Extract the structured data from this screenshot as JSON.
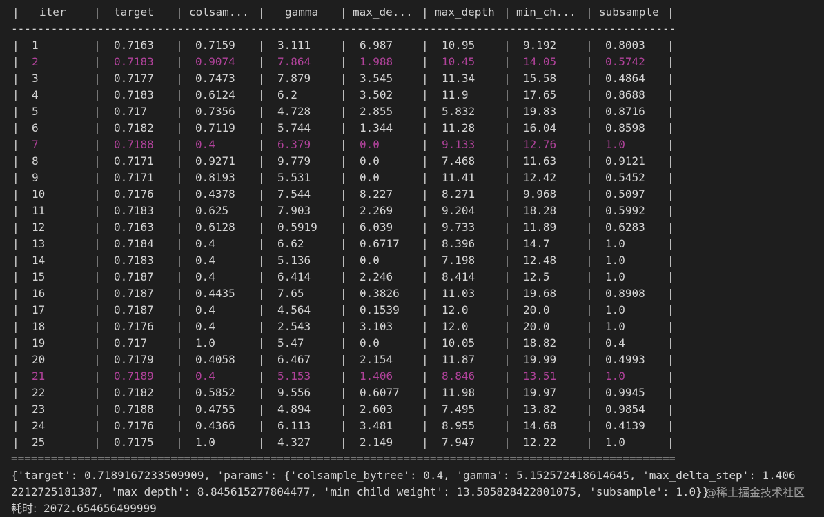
{
  "header": {
    "columns": [
      "iter",
      "target",
      "colsam...",
      "gamma",
      "max_de...",
      "max_depth",
      "min_ch...",
      "subsample"
    ]
  },
  "rows": [
    {
      "highlight": false,
      "cells": [
        "1",
        "0.7163",
        "0.7159",
        "3.111",
        "6.987",
        "10.95",
        "9.192",
        "0.8003"
      ]
    },
    {
      "highlight": true,
      "cells": [
        "2",
        "0.7183",
        "0.9074",
        "7.864",
        "1.988",
        "10.45",
        "14.05",
        "0.5742"
      ]
    },
    {
      "highlight": false,
      "cells": [
        "3",
        "0.7177",
        "0.7473",
        "7.879",
        "3.545",
        "11.34",
        "15.58",
        "0.4864"
      ]
    },
    {
      "highlight": false,
      "cells": [
        "4",
        "0.7183",
        "0.6124",
        "6.2",
        "3.502",
        "11.9",
        "17.65",
        "0.8688"
      ]
    },
    {
      "highlight": false,
      "cells": [
        "5",
        "0.717",
        "0.7356",
        "4.728",
        "2.855",
        "5.832",
        "19.83",
        "0.8716"
      ]
    },
    {
      "highlight": false,
      "cells": [
        "6",
        "0.7182",
        "0.7119",
        "5.744",
        "1.344",
        "11.28",
        "16.04",
        "0.8598"
      ]
    },
    {
      "highlight": true,
      "cells": [
        "7",
        "0.7188",
        "0.4",
        "6.379",
        "0.0",
        "9.133",
        "12.76",
        "1.0"
      ]
    },
    {
      "highlight": false,
      "cells": [
        "8",
        "0.7171",
        "0.9271",
        "9.779",
        "0.0",
        "7.468",
        "11.63",
        "0.9121"
      ]
    },
    {
      "highlight": false,
      "cells": [
        "9",
        "0.7171",
        "0.8193",
        "5.531",
        "0.0",
        "11.41",
        "12.42",
        "0.5452"
      ]
    },
    {
      "highlight": false,
      "cells": [
        "10",
        "0.7176",
        "0.4378",
        "7.544",
        "8.227",
        "8.271",
        "9.968",
        "0.5097"
      ]
    },
    {
      "highlight": false,
      "cells": [
        "11",
        "0.7183",
        "0.625",
        "7.903",
        "2.269",
        "9.204",
        "18.28",
        "0.5992"
      ]
    },
    {
      "highlight": false,
      "cells": [
        "12",
        "0.7163",
        "0.6128",
        "0.5919",
        "6.039",
        "9.733",
        "11.89",
        "0.6283"
      ]
    },
    {
      "highlight": false,
      "cells": [
        "13",
        "0.7184",
        "0.4",
        "6.62",
        "0.6717",
        "8.396",
        "14.7",
        "1.0"
      ]
    },
    {
      "highlight": false,
      "cells": [
        "14",
        "0.7183",
        "0.4",
        "5.136",
        "0.0",
        "7.198",
        "12.48",
        "1.0"
      ]
    },
    {
      "highlight": false,
      "cells": [
        "15",
        "0.7187",
        "0.4",
        "6.414",
        "2.246",
        "8.414",
        "12.5",
        "1.0"
      ]
    },
    {
      "highlight": false,
      "cells": [
        "16",
        "0.7187",
        "0.4435",
        "7.65",
        "0.3826",
        "11.03",
        "19.68",
        "0.8908"
      ]
    },
    {
      "highlight": false,
      "cells": [
        "17",
        "0.7187",
        "0.4",
        "4.564",
        "0.1539",
        "12.0",
        "20.0",
        "1.0"
      ]
    },
    {
      "highlight": false,
      "cells": [
        "18",
        "0.7176",
        "0.4",
        "2.543",
        "3.103",
        "12.0",
        "20.0",
        "1.0"
      ]
    },
    {
      "highlight": false,
      "cells": [
        "19",
        "0.717",
        "1.0",
        "5.47",
        "0.0",
        "10.05",
        "18.82",
        "0.4"
      ]
    },
    {
      "highlight": false,
      "cells": [
        "20",
        "0.7179",
        "0.4058",
        "6.467",
        "2.154",
        "11.87",
        "19.99",
        "0.4993"
      ]
    },
    {
      "highlight": true,
      "cells": [
        "21",
        "0.7189",
        "0.4",
        "5.153",
        "1.406",
        "8.846",
        "13.51",
        "1.0"
      ]
    },
    {
      "highlight": false,
      "cells": [
        "22",
        "0.7182",
        "0.5852",
        "9.556",
        "0.6077",
        "11.98",
        "19.97",
        "0.9945"
      ]
    },
    {
      "highlight": false,
      "cells": [
        "23",
        "0.7188",
        "0.4755",
        "4.894",
        "2.603",
        "7.495",
        "13.82",
        "0.9854"
      ]
    },
    {
      "highlight": false,
      "cells": [
        "24",
        "0.7176",
        "0.4366",
        "6.113",
        "3.481",
        "8.955",
        "14.68",
        "0.4139"
      ]
    },
    {
      "highlight": false,
      "cells": [
        "25",
        "0.7175",
        "1.0",
        "4.327",
        "2.149",
        "7.947",
        "12.22",
        "1.0"
      ]
    }
  ],
  "separator_char": "|",
  "header_rule_char": "-",
  "footer_rule_char": "=",
  "result_line_1": "{'target': 0.7189167233509909, 'params': {'colsample_bytree': 0.4, 'gamma': 5.152572418614645, 'max_delta_step': 1.406",
  "result_line_2": "2212725181387, 'max_depth': 8.845615277804477, 'min_child_weight': 13.505828422801075, 'subsample': 1.0}}",
  "timing_label": "耗时:",
  "timing_value": " 2072.654656499999",
  "watermark": "@稀土掘金技术社区",
  "colors": {
    "background": "#1e1e1e",
    "text": "#d4d4d4",
    "highlight": "#b0429a"
  }
}
